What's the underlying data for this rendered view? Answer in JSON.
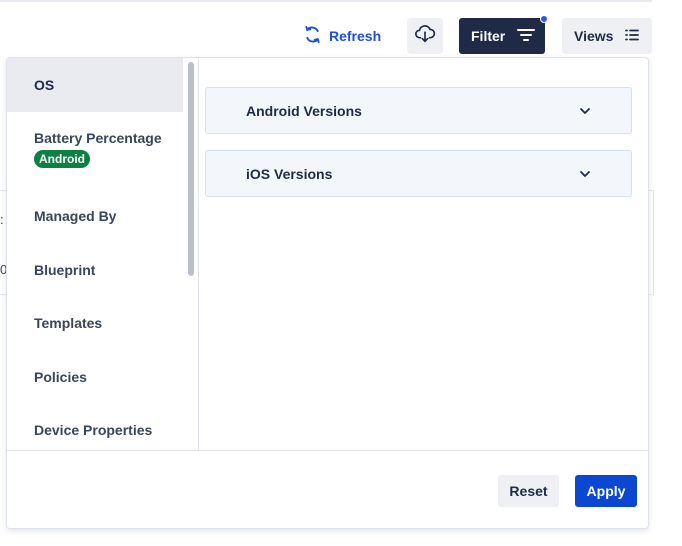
{
  "toolbar": {
    "refresh_label": "Refresh",
    "refresh_icon": "refresh-icon",
    "download_icon": "cloud-download-icon",
    "filter_label": "Filter",
    "filter_icon": "filter-lines-icon",
    "filter_active_indicator": true,
    "views_label": "Views",
    "views_icon": "list-icon"
  },
  "background": {
    "fragments": [
      ":",
      "0"
    ]
  },
  "filter_panel": {
    "categories": [
      {
        "label": "OS",
        "active": true
      },
      {
        "label": "Battery Percentage",
        "badge": "Android"
      },
      {
        "label": "Managed By"
      },
      {
        "label": "Blueprint"
      },
      {
        "label": "Templates"
      },
      {
        "label": "Policies"
      },
      {
        "label": "Device Properties"
      }
    ],
    "sections": [
      {
        "label": "Android Versions",
        "icon": "chevron-down-icon"
      },
      {
        "label": "iOS Versions",
        "icon": "chevron-down-icon"
      }
    ],
    "reset_label": "Reset",
    "apply_label": "Apply"
  },
  "colors": {
    "primary": "#0b47d1",
    "filter_button": "#1e2a46",
    "badge_android": "#0d8043",
    "link": "#1f4fd6"
  }
}
